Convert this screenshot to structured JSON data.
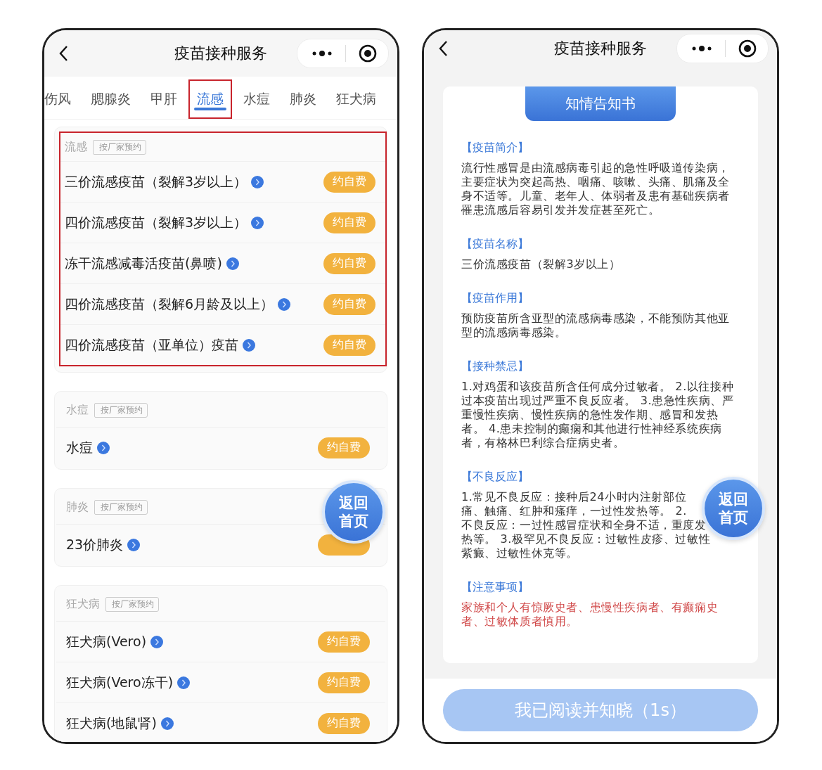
{
  "left_screen": {
    "title": "疫苗接种服务",
    "tabs": [
      {
        "label": "伤风",
        "selected": false,
        "highlighted": false
      },
      {
        "label": "腮腺炎",
        "selected": false,
        "highlighted": false
      },
      {
        "label": "甲肝",
        "selected": false,
        "highlighted": false
      },
      {
        "label": "流感",
        "selected": true,
        "highlighted": true
      },
      {
        "label": "水痘",
        "selected": false,
        "highlighted": false
      },
      {
        "label": "肺炎",
        "selected": false,
        "highlighted": false
      },
      {
        "label": "狂犬病",
        "selected": false,
        "highlighted": false
      }
    ],
    "sections": [
      {
        "name": "流感",
        "tag": "按厂家预约",
        "highlighted": true,
        "items": [
          {
            "name": "三价流感疫苗（裂解3岁以上）",
            "button": "约自费"
          },
          {
            "name": "四价流感疫苗（裂解3岁以上）",
            "button": "约自费"
          },
          {
            "name": "冻干流感减毒活疫苗(鼻喷)",
            "button": "约自费"
          },
          {
            "name": "四价流感疫苗（裂解6月龄及以上）",
            "button": "约自费"
          },
          {
            "name": "四价流感疫苗（亚单位）疫苗",
            "button": "约自费"
          }
        ]
      },
      {
        "name": "水痘",
        "tag": "按厂家预约",
        "highlighted": false,
        "items": [
          {
            "name": "水痘",
            "button": "约自费"
          }
        ]
      },
      {
        "name": "肺炎",
        "tag": "按厂家预约",
        "highlighted": false,
        "items": [
          {
            "name": "23价肺炎"
          }
        ]
      },
      {
        "name": "狂犬病",
        "tag": "按厂家预约",
        "highlighted": false,
        "items": [
          {
            "name": "狂犬病(Vero)",
            "button": "约自费"
          },
          {
            "name": "狂犬病(Vero冻干)",
            "button": "约自费"
          },
          {
            "name": "狂犬病(地鼠肾)",
            "button": "约自费"
          }
        ]
      }
    ],
    "home_button": "返回首页"
  },
  "right_screen": {
    "title": "疫苗接种服务",
    "banner": "知情告知书",
    "sections": [
      {
        "heading": "【疫苗简介】",
        "kind": "normal",
        "body": "流行性感冒是由流感病毒引起的急性呼吸道传染病，主要症状为突起高热、咽痛、咳嗽、头痛、肌痛及全身不适等。儿童、老年人、体弱者及患有基础疾病者罹患流感后容易引发并发症甚至死亡。"
      },
      {
        "heading": "【疫苗名称】",
        "kind": "normal",
        "body": "三价流感疫苗（裂解3岁以上）"
      },
      {
        "heading": "【疫苗作用】",
        "kind": "normal",
        "body": "预防疫苗所含亚型的流感病毒感染，不能预防其他亚型的流感病毒感染。"
      },
      {
        "heading": "【接种禁忌】",
        "kind": "normal",
        "body": "1.对鸡蛋和该疫苗所含任何成分过敏者。 2.以往接种过本疫苗出现过严重不良反应者。 3.患急性疾病、严重慢性疾病、慢性疾病的急性发作期、感冒和发热者。 4.患未控制的癫痫和其他进行性神经系统疾病者，有格林巴利综合症病史者。"
      },
      {
        "heading": "【不良反应】",
        "kind": "lines",
        "lines": [
          "1.常见不良反应：接种后24小时内注射部位",
          "痛、触痛、红肿和瘙痒，一过性发热等。 2.",
          "不良反应：一过性感冒症状和全身不适，重度发",
          "热等。 3.极罕见不良反应：过敏性皮疹、过敏性",
          "紫癜、过敏性休克等。"
        ]
      },
      {
        "heading": "【注意事项】",
        "kind": "warning",
        "body": "家族和个人有惊厥史者、患慢性疾病者、有癫痫史者、过敏体质者慎用。"
      }
    ],
    "confirm_button": {
      "label": "我已阅读并知晓（1s）",
      "disabled": true
    },
    "home_button": "返回首页"
  }
}
